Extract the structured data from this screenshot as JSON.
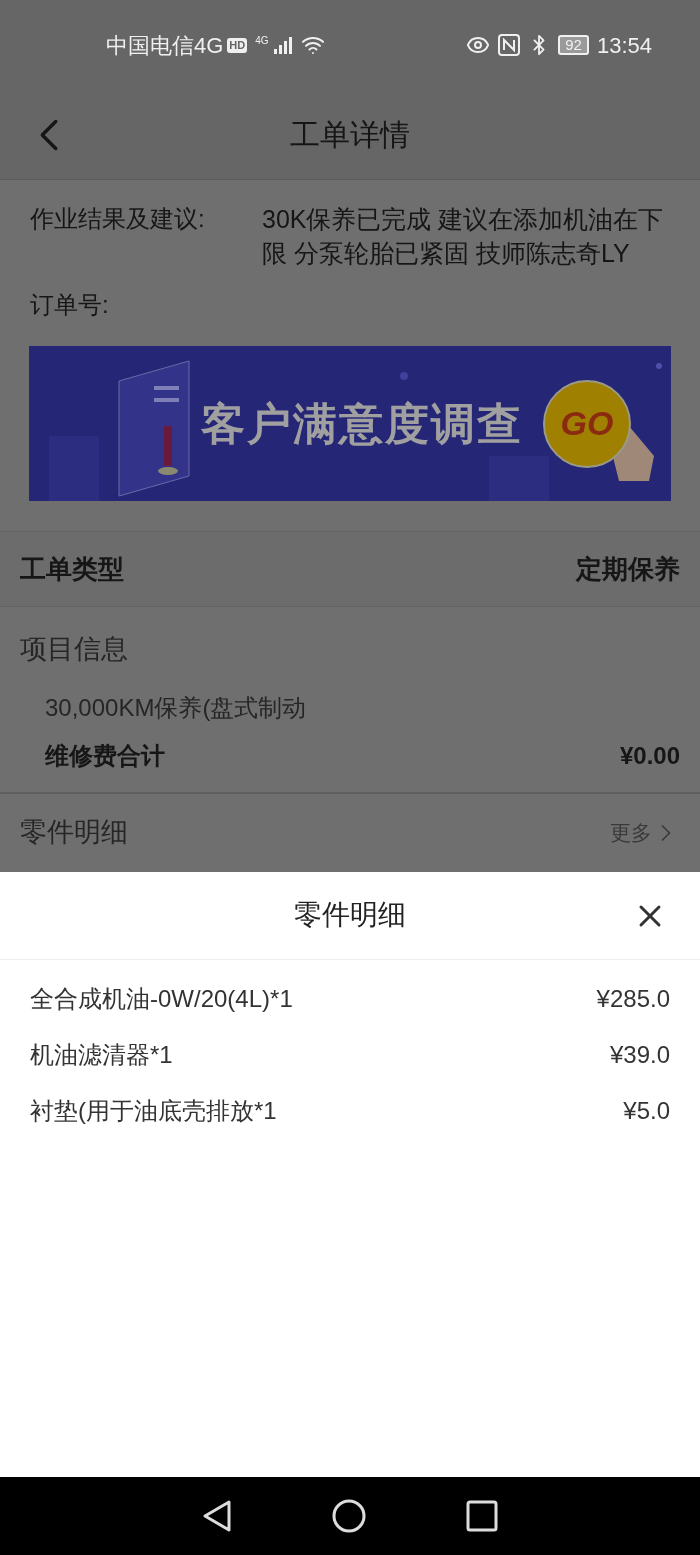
{
  "status_bar": {
    "carrier": "中国电信4G",
    "hd": "HD",
    "network": "4G",
    "battery": "92",
    "time": "13:54"
  },
  "header": {
    "title": "工单详情"
  },
  "details": [
    {
      "label": "作业结果及建议:",
      "value": "30K保养已完成 建议在添加机油在下限 分泵轮胎已紧固 技师陈志奇LY"
    },
    {
      "label": "订单号:"
    }
  ],
  "banner": {
    "title": "客户满意度调查",
    "button": "GO"
  },
  "order_type": {
    "label": "工单类型",
    "value": "定期保养"
  },
  "project": {
    "title": "项目信息",
    "entries": [
      "30,000KM保养(盘式制动"
    ],
    "total_label": "维修费合计",
    "total": "¥0.00"
  },
  "parts": {
    "title": "零件明细",
    "more": "更多"
  },
  "sheet": {
    "title": "零件明细",
    "rows": [
      {
        "name": "全合成机油-0W/20(4L)*1",
        "price": "¥285.0"
      },
      {
        "name": "机油滤清器*1",
        "price": "¥39.0"
      },
      {
        "name": "衬垫(用于油底壳排放*1",
        "price": "¥5.0"
      }
    ]
  }
}
